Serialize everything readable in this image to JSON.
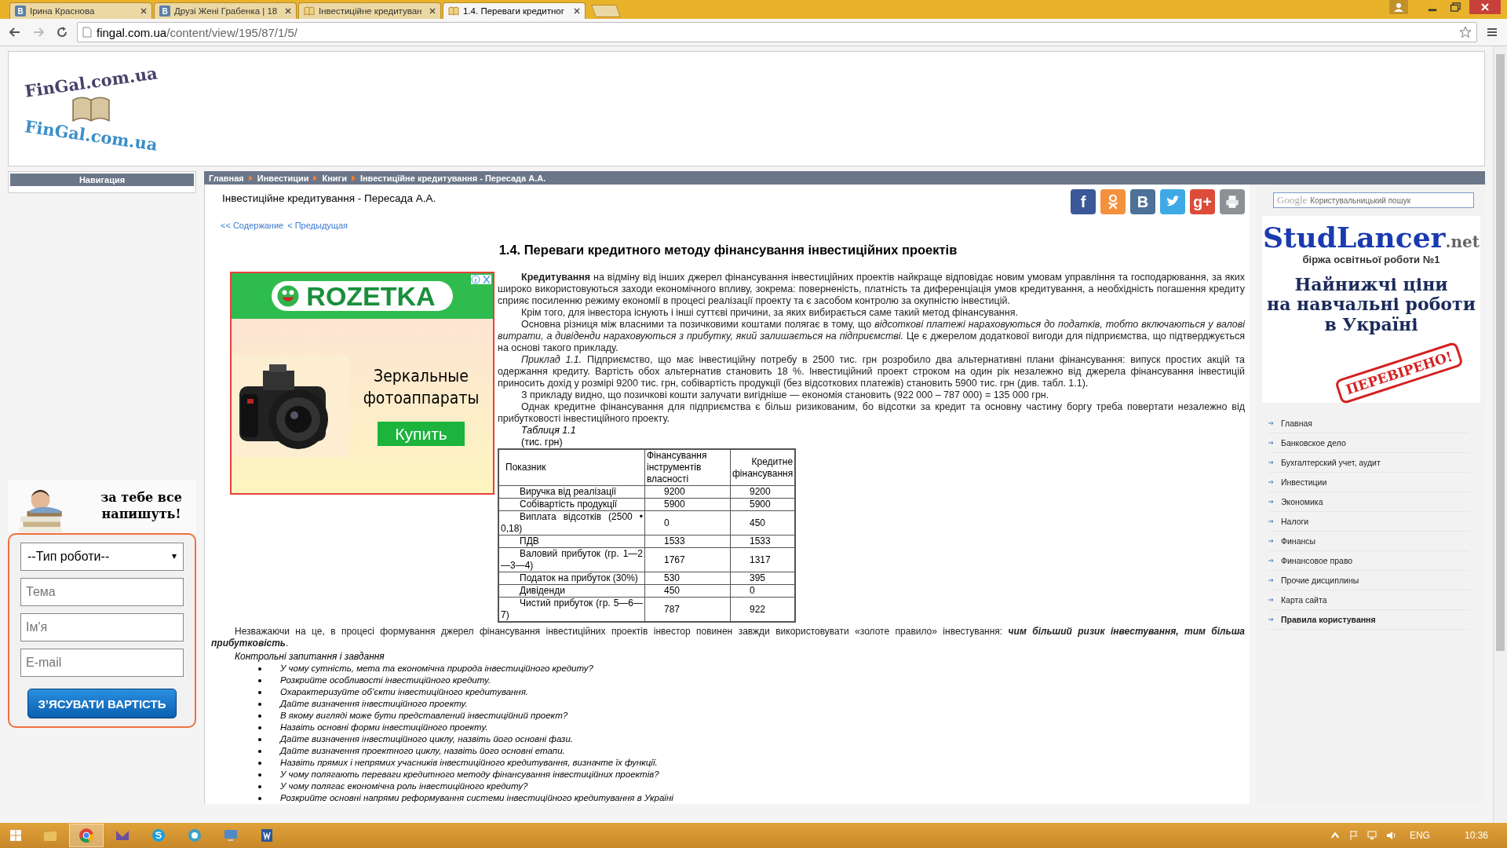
{
  "browser": {
    "tabs": [
      {
        "label": "Ірина Краснова",
        "kind": "vk",
        "glyph": "В",
        "selected": false
      },
      {
        "label": "Друзі Жені Грабенка | 18",
        "kind": "vk",
        "glyph": "В",
        "selected": false
      },
      {
        "label": "Інвестиційне кредитуван",
        "kind": "book",
        "selected": false
      },
      {
        "label": "1.4. Переваги кредитног",
        "kind": "book",
        "selected": true
      }
    ],
    "url_host": "fingal.com.ua",
    "url_path": "/content/view/195/87/1/5/"
  },
  "logo": {
    "text": "FinGal.com.ua",
    "reflection": "FinGal.com.ua"
  },
  "nav": {
    "title": "Навигация"
  },
  "promo": {
    "headline": "за тебе все напишуть!",
    "select": "--Тип роботи--",
    "fields": [
      {
        "placeholder": "Тема"
      },
      {
        "placeholder": "Ім'я"
      },
      {
        "placeholder": "E-mail"
      }
    ],
    "button": "З’ЯСУВАТИ ВАРТІСТЬ"
  },
  "breadcrumb": [
    "Главная",
    "Инвестиции",
    "Книги",
    "Інвестиційне кредитування - Пересада А.А."
  ],
  "article": {
    "book_title": "Інвестиційне кредитування - Пересада А.А.",
    "links": [
      "<< Содержание",
      "< Предыдущая"
    ],
    "share": [
      {
        "kind": "facebook",
        "glyph": "f"
      },
      {
        "kind": "odnoklassniki"
      },
      {
        "kind": "vk",
        "glyph": "B"
      },
      {
        "kind": "twitter"
      },
      {
        "kind": "gplus",
        "glyph": "g+"
      },
      {
        "kind": "print"
      }
    ],
    "heading": "1.4. Переваги кредитного методу фінансування інвестиційних проектів",
    "ad": {
      "brand": "ROZETKA",
      "text": "Зеркальные фотоаппараты",
      "button": "Купить"
    },
    "paragraphs": [
      "**Кредитування** на відміну від інших джерел фінансування інвестиційних проектів найкраще відповідає новим умовам управління та господарювання, за яких широко використовуються заходи економічного впливу, зокрема: поверненість, платність та диференціація умов кредитування, а необхідність погашення кредиту сприяє посиленню режиму економії в процесі реалізації проекту та є засобом контролю за окупністю інвестицій.",
      "Крім того, для інвестора існують і інші суттєві причини, за яких вибирається саме такий метод фінансування.",
      "Основна різниця між власними та позичковими коштами полягає в тому, що *відсоткові платежі нараховуються до податків, тобто включаються у валові витрати, а дивіденди нараховуються з прибутку, який залишається на підприємстві.* Це є джерелом додаткової вигоди для підприємства, що підтверджується на основі такого прикладу.",
      "*Приклад 1.1.* Підприємство, що має інвестиційну потребу в 2500 тис. грн розробило два альтернативні плани фінансування: випуск простих акцій та одержання кредиту. Вартість обох альтернатив становить 18 %. Інвестиційний проект строком на один рік незалежно від джерела фінансування інвестицій приносить дохід у розмірі 9200 тис. грн, собівартість продукції (без відсоткових платежів) становить 5900 тис. грн (див. табл. 1.1).",
      "З прикладу видно, що позичкові кошти залучати вигідніше — економія становить (922 000 – 787 000) = 135 000 грн.",
      "Однак кредитне фінансування для підприємства є більш ризикованим, бо відсотки за кредит та основну частину боргу треба повертати незалежно від прибутковості інвестиційного проекту."
    ],
    "table": {
      "caption": "Таблиця 1.1",
      "unit": "(тис. грн)",
      "columns": [
        "Показник",
        "Фінансування інструментів власності",
        "Кредитне фінансування"
      ],
      "rows": [
        [
          "Виручка від реалізації",
          "9200",
          "9200"
        ],
        [
          "Собівартість продукції",
          "5900",
          "5900"
        ],
        [
          "Виплата відсотків (2500 • 0,18)",
          "0",
          "450"
        ],
        [
          "ПДВ",
          "1533",
          "1533"
        ],
        [
          "Валовий прибуток (гр. 1—2—3—4)",
          "1767",
          "1317"
        ],
        [
          "Податок на прибуток (30%)",
          "530",
          "395"
        ],
        [
          "Дивіденди",
          "450",
          "0"
        ],
        [
          "Чистий прибуток (гр. 5—6—7)",
          "787",
          "922"
        ]
      ]
    },
    "conclusion": "Незважаючи на це, в процесі формування джерел фінансування інвестиційних проектів інвестор повинен завжди використовувати «золоте правило» інвестування: **чим більший ризик інвестування, тим більша прибутковість**.",
    "questions_title": "Контрольні запитання і завдання",
    "questions": [
      "У чому сутність, мета та економічна природа інвестиційного кредиту?",
      "Розкрийте особливості інвестиційного кредиту.",
      "Охарактеризуйте об’єкти інвестиційного кредитування.",
      "Дайте визначення інвестиційного проекту.",
      "В якому вигляді може бути представлений інвестиційний проект?",
      "Назвіть основні форми інвестиційного проекту.",
      "Дайте визначення інвестиційного циклу, назвіть його основні фази.",
      "Дайте визначення проектного циклу, назвіть його основні етапи.",
      "Назвіть прямих і непрямих учасників інвестиційного кредитування, визначте їх функції.",
      "У чому полягають переваги кредитного методу фінансування інвестиційних проектів?",
      "У чому полягає економічна роль інвестиційного кредиту?",
      "Розкрийте основні напрями реформування системи інвестиційного кредитування в Україні"
    ]
  },
  "sidebar": {
    "search": {
      "brand": "Google",
      "placeholder": "Користувальницький пошук"
    },
    "ad": {
      "logo": "StudLancer",
      "logo_suffix": ".net",
      "tagline": "біржа освітньої роботи №1",
      "headline": [
        "Найнижчі ціни",
        "на навчальні роботи",
        "в Україні"
      ],
      "stamp": "ПЕРЕВІРЕНО!"
    },
    "menu": [
      {
        "label": "Главная",
        "emphasized": false
      },
      {
        "label": "Банковское дело",
        "emphasized": false
      },
      {
        "label": "Бухгалтерский учет, аудит",
        "emphasized": false
      },
      {
        "label": "Инвестиции",
        "emphasized": false
      },
      {
        "label": "Экономика",
        "emphasized": false
      },
      {
        "label": "Налоги",
        "emphasized": false
      },
      {
        "label": "Финансы",
        "emphasized": false
      },
      {
        "label": "Финансовое право",
        "emphasized": false
      },
      {
        "label": "Прочие дисциплины",
        "emphasized": false
      },
      {
        "label": "Карта сайта",
        "emphasized": false
      },
      {
        "label": "Правила користування",
        "emphasized": true
      }
    ]
  },
  "taskbar": {
    "apps": [
      {
        "kind": "explorer",
        "active": false
      },
      {
        "kind": "chrome",
        "active": true
      },
      {
        "kind": "mail",
        "active": false
      },
      {
        "kind": "skype",
        "active": false
      },
      {
        "kind": "circle",
        "active": false
      },
      {
        "kind": "remote",
        "active": false
      },
      {
        "kind": "word",
        "active": false
      }
    ],
    "language": "ENG",
    "time": "10:36"
  }
}
